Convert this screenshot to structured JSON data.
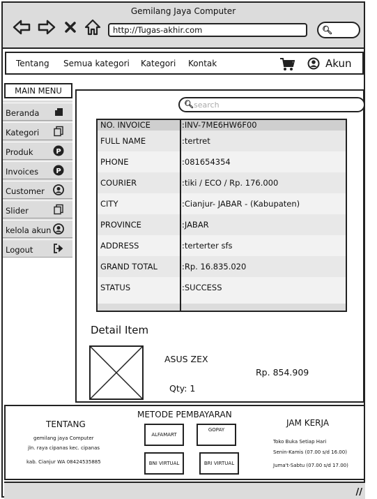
{
  "window": {
    "title": "Gemilang Jaya Computer",
    "url": "http://Tugas-akhir.com"
  },
  "nav": {
    "items": [
      "Tentang",
      "Semua kategori",
      "Kategori",
      "Kontak"
    ],
    "account_label": "Akun"
  },
  "sidebar": {
    "header": "MAIN MENU",
    "items": [
      {
        "label": "Beranda",
        "icon": "square-icon"
      },
      {
        "label": "Kategori",
        "icon": "copy-icon"
      },
      {
        "label": "Produk",
        "icon": "p-circle-icon"
      },
      {
        "label": "Invoices",
        "icon": "p-circle-icon"
      },
      {
        "label": "Customer",
        "icon": "user-icon"
      },
      {
        "label": "Slider",
        "icon": "copy-icon"
      },
      {
        "label": "kelola akun",
        "icon": "user-icon"
      },
      {
        "label": "Logout",
        "icon": "logout-icon"
      }
    ]
  },
  "search": {
    "placeholder": "search"
  },
  "invoice": {
    "rows": [
      {
        "key": "NO. INVOICE",
        "value": ":INV-7ME6HW6F00"
      },
      {
        "key": "FULL NAME",
        "value": ":tertret"
      },
      {
        "key": "PHONE",
        "value": ":081654354"
      },
      {
        "key": "COURIER",
        "value": ":tiki / ECO / Rp. 176.000"
      },
      {
        "key": "CITY",
        "value": ":Cianjur- JABAR - (Kabupaten)"
      },
      {
        "key": "PROVINCE",
        "value": ":JABAR"
      },
      {
        "key": "ADDRESS",
        "value": ":terterter sfs"
      },
      {
        "key": "GRAND TOTAL",
        "value": ":Rp. 16.835.020"
      },
      {
        "key": "STATUS",
        "value": ":SUCCESS"
      }
    ]
  },
  "detail": {
    "title": "Detail Item",
    "item_name": "ASUS ZEX",
    "price": "Rp. 854.909",
    "qty": "Qty: 1"
  },
  "footer": {
    "tentang_title": "TENTANG",
    "tentang_lines": [
      "gemilang jaya Computer",
      "jln. raya cipanas kec. cipanas",
      "kab. Cianjur WA 08424535885"
    ],
    "payment_title": "METODE PEMBAYARAN",
    "payments": [
      "ALFAMART",
      "GOPAY",
      "BNI VIRTUAL",
      "BRI VIRTUAL"
    ],
    "hours_title": "JAM KERJA",
    "hours_lines": [
      "Toko Buka Setiap Hari",
      "Senin-Kamis (07.00 s/d 16.00)",
      "Juma't-Sabtu (07.00 s/d 17.00)"
    ]
  }
}
